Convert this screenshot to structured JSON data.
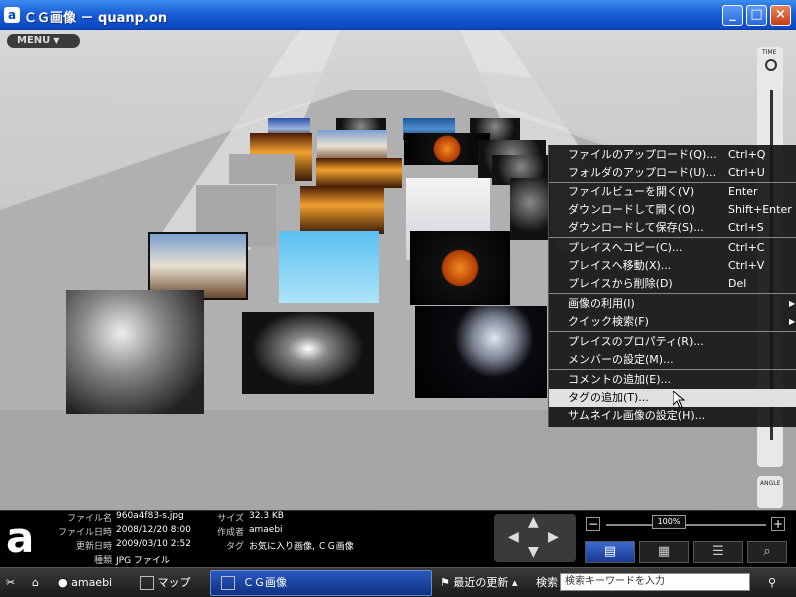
{
  "window": {
    "title": "ＣＧ画像 － quanp.on",
    "logo_letter": "a",
    "minimize": "_",
    "maximize": "□",
    "close": "×"
  },
  "viewer": {
    "menu_label": "MENU",
    "menu_arrow": "▼",
    "time_label": "TIME",
    "angle_label": "ANGLE"
  },
  "context_menu": {
    "items": [
      {
        "label": "ファイルのアップロード(Q)...",
        "shortcut": "Ctrl+Q"
      },
      {
        "label": "フォルダのアップロード(U)...",
        "shortcut": "Ctrl+U"
      },
      {
        "label": "ファイルビューを開く(V)",
        "shortcut": "Enter"
      },
      {
        "label": "ダウンロードして開く(O)",
        "shortcut": "Shift+Enter"
      },
      {
        "label": "ダウンロードして保存(S)...",
        "shortcut": "Ctrl+S"
      },
      {
        "label": "プレイスへコピー(C)...",
        "shortcut": "Ctrl+C"
      },
      {
        "label": "プレイスへ移動(X)...",
        "shortcut": "Ctrl+V"
      },
      {
        "label": "プレイスから削除(D)",
        "shortcut": "Del"
      },
      {
        "label": "画像の利用(I)",
        "shortcut": "",
        "submenu": true
      },
      {
        "label": "クイック検索(F)",
        "shortcut": "",
        "submenu": true
      },
      {
        "label": "プレイスのプロパティ(R)...",
        "shortcut": ""
      },
      {
        "label": "メンバーの設定(M)...",
        "shortcut": ""
      },
      {
        "label": "コメントの追加(E)...",
        "shortcut": ""
      },
      {
        "label": "タグの追加(T)...",
        "shortcut": "",
        "highlighted": true
      },
      {
        "label": "サムネイル画像の設定(H)...",
        "shortcut": ""
      }
    ],
    "submenu_arrow": "▶"
  },
  "info": {
    "filename_label": "ファイル名",
    "filename": "960a4f83-s.jpg",
    "created_label": "ファイル日時",
    "created": "2008/12/20 8:00",
    "updated_label": "更新日時",
    "updated": "2009/03/10 2:52",
    "type_label": "種類",
    "type": "JPG ファイル",
    "size_label": "サイズ",
    "size": "32.3 KB",
    "author_label": "作成者",
    "author": "amaebi",
    "tag_label": "タグ",
    "tags": "お気に入り画像, ＣＧ画像",
    "zoom": "100%",
    "zoom_minus": "−",
    "zoom_plus": "+"
  },
  "bottombar": {
    "user": "amaebi",
    "map_label": "マップ",
    "active_tab": "ＣＧ画像",
    "recent_label": "最近の更新",
    "search_label": "検索",
    "search_placeholder": "検索キーワードを入力"
  }
}
